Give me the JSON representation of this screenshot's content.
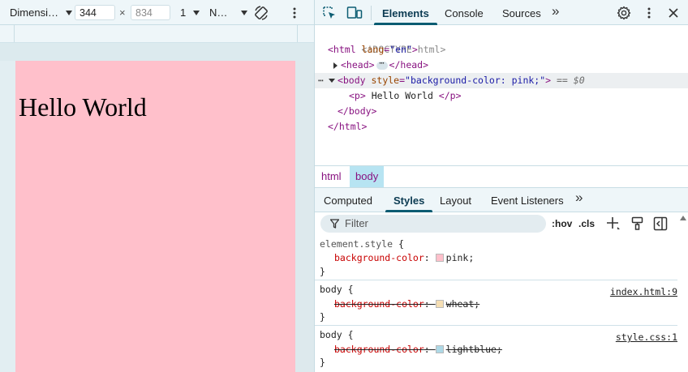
{
  "device_toolbar": {
    "dimensions_label": "Dimensi…",
    "width_value": "344",
    "times_symbol": "×",
    "height_placeholder": "834",
    "zoom_value": "1",
    "throttle_label": "N…"
  },
  "viewport": {
    "heading_text": "Hello World",
    "background": "#ffc0cb"
  },
  "devtools_tabs": {
    "items": [
      "Elements",
      "Console",
      "Sources"
    ],
    "more": "»"
  },
  "dom_tree": {
    "doctype": "<!DOCTYPE html>",
    "html_open_tag": "<html",
    "html_attr_name": " lang",
    "html_attr_value": "\"en\"",
    "head_open": "<head>",
    "head_ellipsis": "⋯",
    "head_close": "</head>",
    "row_dots": "⋯",
    "body_open_tag": "<body",
    "body_attr_name": " style",
    "body_attr_value": "\"background-color: pink;\"",
    "dollar_zero": " == $0",
    "p_open": "<p>",
    "p_text": " Hello World ",
    "p_close": "</p>",
    "body_close": "</body>",
    "html_close": "</html>"
  },
  "breadcrumbs": [
    "html",
    "body"
  ],
  "styles_tabs": {
    "items": [
      "Computed",
      "Styles",
      "Layout",
      "Event Listeners"
    ],
    "more": "»"
  },
  "filter": {
    "placeholder": "Filter",
    "hov": ":hov",
    "cls": ".cls"
  },
  "style_rules": [
    {
      "selector": "element.style",
      "open": " {",
      "property": "background-color",
      "value": "pink",
      "swatch": "#ffc0cb",
      "overridden": false,
      "source": "",
      "close": "}"
    },
    {
      "selector": "body",
      "open": " {",
      "property": "background-color",
      "value": "wheat",
      "swatch": "#f5deb3",
      "overridden": true,
      "source": "index.html:9",
      "close": "}"
    },
    {
      "selector": "body",
      "open": " {",
      "property": "background-color",
      "value": "lightblue",
      "swatch": "#add8e6",
      "overridden": true,
      "source": "style.css:1",
      "close": "}"
    }
  ],
  "colors": {
    "accent": "#0b5c72",
    "tag": "#881280",
    "attribute_name": "#994500",
    "attribute_value": "#1a1aa6",
    "property_name": "#c80000"
  },
  "icons": [
    "inspect-icon",
    "device-toggle-icon",
    "rotate-icon",
    "kebab-icon",
    "settings-icon",
    "close-icon",
    "filter-icon",
    "new-rule-icon",
    "paint-brush-icon",
    "sidebar-toggle-icon"
  ]
}
